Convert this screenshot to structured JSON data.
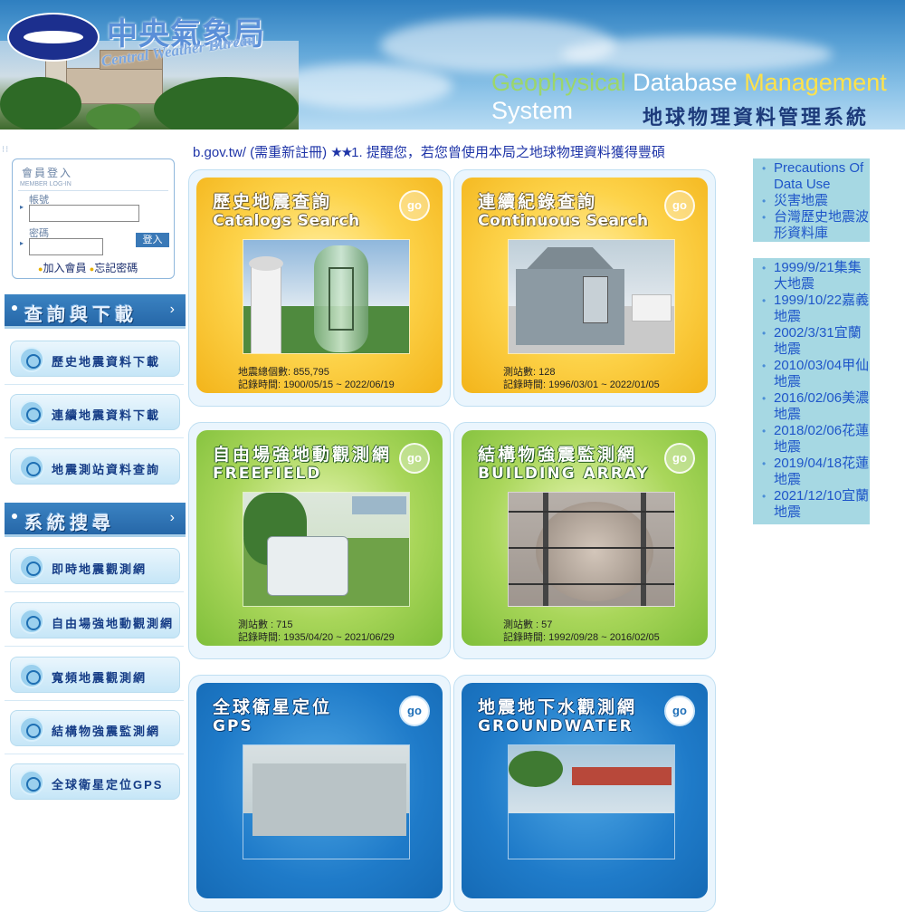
{
  "header": {
    "logo_cn": "中央氣象局",
    "logo_en": "Central Weather Bureau",
    "system_en": {
      "geophysical": "Geophysical",
      "database": " Database ",
      "management": "Management",
      "system": " System"
    },
    "system_cn": "地球物理資料管理系統"
  },
  "login": {
    "title": "會員登入",
    "subtitle": "MEMBER LOG-IN",
    "account_label": "帳號",
    "password_label": "密碼",
    "account_value": "",
    "password_value": "",
    "submit": "登入",
    "register": "加入會員",
    "forgot": "忘記密碼"
  },
  "sections": [
    {
      "label": "查詢與下載",
      "items": [
        "歷史地震資料下載",
        "連續地震資料下載",
        "地震測站資料查詢"
      ]
    },
    {
      "label": "系統搜尋",
      "items": [
        "即時地震觀測網",
        "自由場強地動觀測網",
        "寬頻地震觀測網",
        "結構物強震監測網",
        "全球衛星定位GPS"
      ]
    }
  ],
  "marquee": {
    "prefix": "b.gov.tw/ (需重新註冊) ",
    "stars": "★★",
    "text": "1. 提醒您，若您曾使用本局之地球物理資料獲得豐碩"
  },
  "cards": [
    {
      "title_cn": "歷史地震查詢",
      "title_en": "Catalogs Search",
      "go": "go",
      "theme": "orange",
      "stat1": "地震總個數: 855,795",
      "stat2": "記錄時間: 1900/05/15 ~ 2022/06/19"
    },
    {
      "title_cn": "連續紀錄查詢",
      "title_en": "Continuous Search",
      "go": "go",
      "theme": "orange",
      "stat1": "測站數: 128",
      "stat2": "記錄時間: 1996/03/01 ~ 2022/01/05"
    },
    {
      "title_cn": "自由場強地動觀測網",
      "title_en": "FREEFIELD",
      "go": "go",
      "theme": "green",
      "stat1": "測站數 : 715",
      "stat2": "記錄時間: 1935/04/20 ~ 2021/06/29"
    },
    {
      "title_cn": "結構物強震監測網",
      "title_en": "BUILDING ARRAY",
      "go": "go",
      "theme": "green",
      "stat1": "測站數 : 57",
      "stat2": "記錄時間: 1992/09/28 ~ 2016/02/05"
    },
    {
      "title_cn": "全球衛星定位",
      "title_en": "GPS",
      "go": "go",
      "theme": "blue"
    },
    {
      "title_cn": "地震地下水觀測網",
      "title_en": "GROUNDWATER",
      "go": "go",
      "theme": "blue"
    }
  ],
  "right_panel_1": [
    "Precautions Of Data Use",
    "災害地震",
    "台灣歷史地震波形資料庫"
  ],
  "right_panel_2": [
    "1999/9/21集集大地震",
    "1999/10/22嘉義地震",
    "2002/3/31宜蘭地震",
    "2010/03/04甲仙地震",
    "2016/02/06美濃地震",
    "2018/02/06花蓮地震",
    "2019/04/18花蓮地震",
    "2021/12/10宜蘭地震"
  ]
}
